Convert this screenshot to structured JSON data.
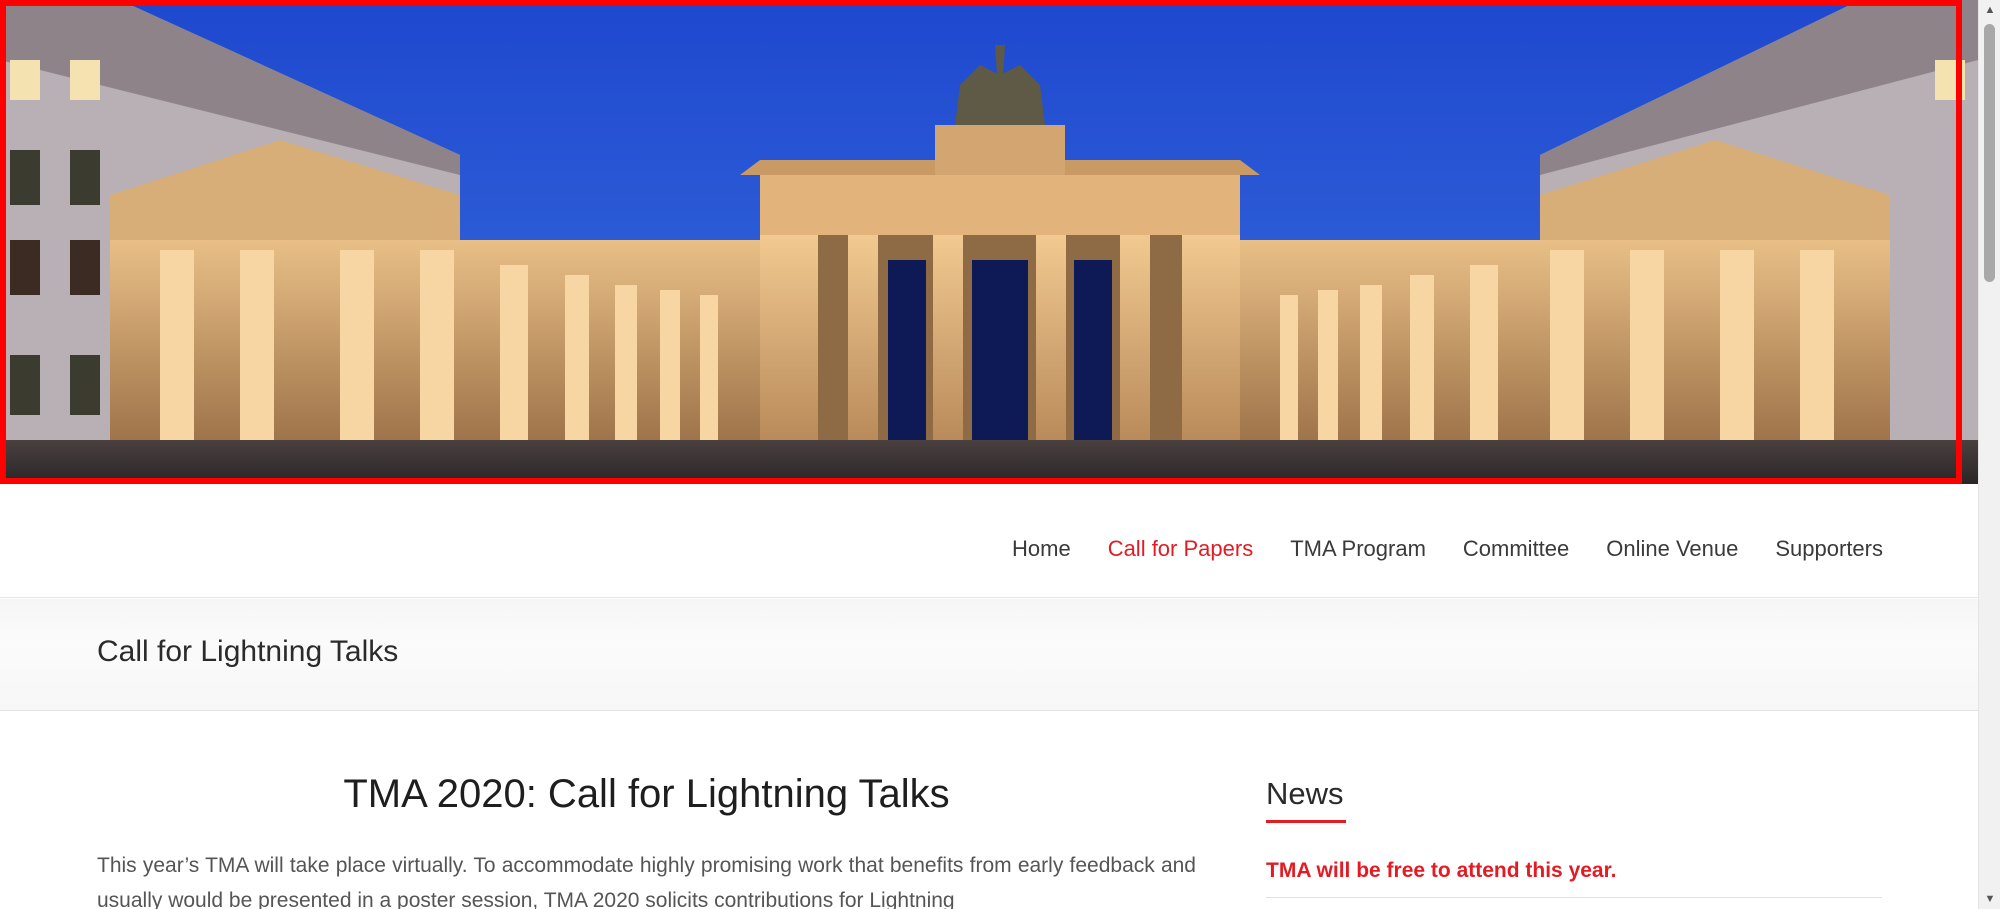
{
  "hero": {
    "image_name": "brandenburg-gate-night-photo",
    "frame_color": "#ff0000"
  },
  "nav": {
    "items": [
      {
        "label": "Home",
        "active": false
      },
      {
        "label": "Call for Papers",
        "active": true
      },
      {
        "label": "TMA Program",
        "active": false
      },
      {
        "label": "Committee",
        "active": false
      },
      {
        "label": "Online Venue",
        "active": false
      },
      {
        "label": "Supporters",
        "active": false
      }
    ],
    "active_color": "#e31b23"
  },
  "page": {
    "title": "Call for Lightning Talks"
  },
  "main": {
    "heading": "TMA 2020: Call for Lightning Talks",
    "intro": "This year’s TMA will take place virtually. To accommodate highly promising work that benefits from early feedback and usually would be presented in a poster session, TMA 2020 solicits contributions for Lightning"
  },
  "sidebar": {
    "news_title": "News",
    "news_items": [
      {
        "label": "TMA will be free to attend this year."
      }
    ]
  },
  "scrollbar": {
    "up_icon": "scroll-up-arrow-icon",
    "down_icon": "scroll-down-arrow-icon"
  }
}
